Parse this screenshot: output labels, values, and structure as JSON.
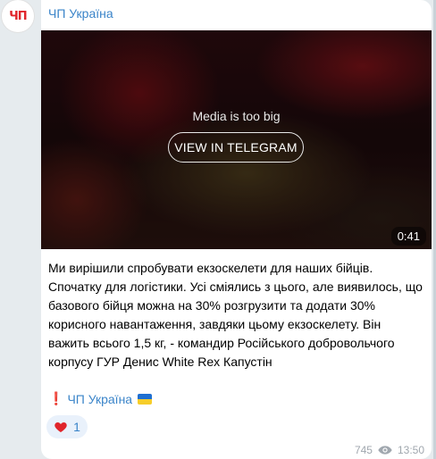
{
  "channel": {
    "avatar_text": "ЧП",
    "name": "ЧП Україна"
  },
  "media": {
    "message": "Media is too big",
    "button_label": "VIEW IN TELEGRAM",
    "duration": "0:41"
  },
  "post": {
    "text": "Ми вирішили спробувати екзоскелети для наших бійців. Спочатку для логістики. Усі сміялись з цього, але виявилось, що базового бійця можна на 30% розгрузити та додати 30% корисного навантаження, завдяки цьому екзоскелету. Він важить всього 1,5 кг, - командир Російського добровольчого корпусу ГУР Денис White Rex Капустін",
    "signature_mark": "❗",
    "signature": "ЧП Україна"
  },
  "reactions": [
    {
      "icon": "heart-icon",
      "count": "1"
    }
  ],
  "footer": {
    "views": "745",
    "time": "13:50"
  },
  "colors": {
    "accent": "#3a84c9",
    "brand": "#e0252b"
  }
}
